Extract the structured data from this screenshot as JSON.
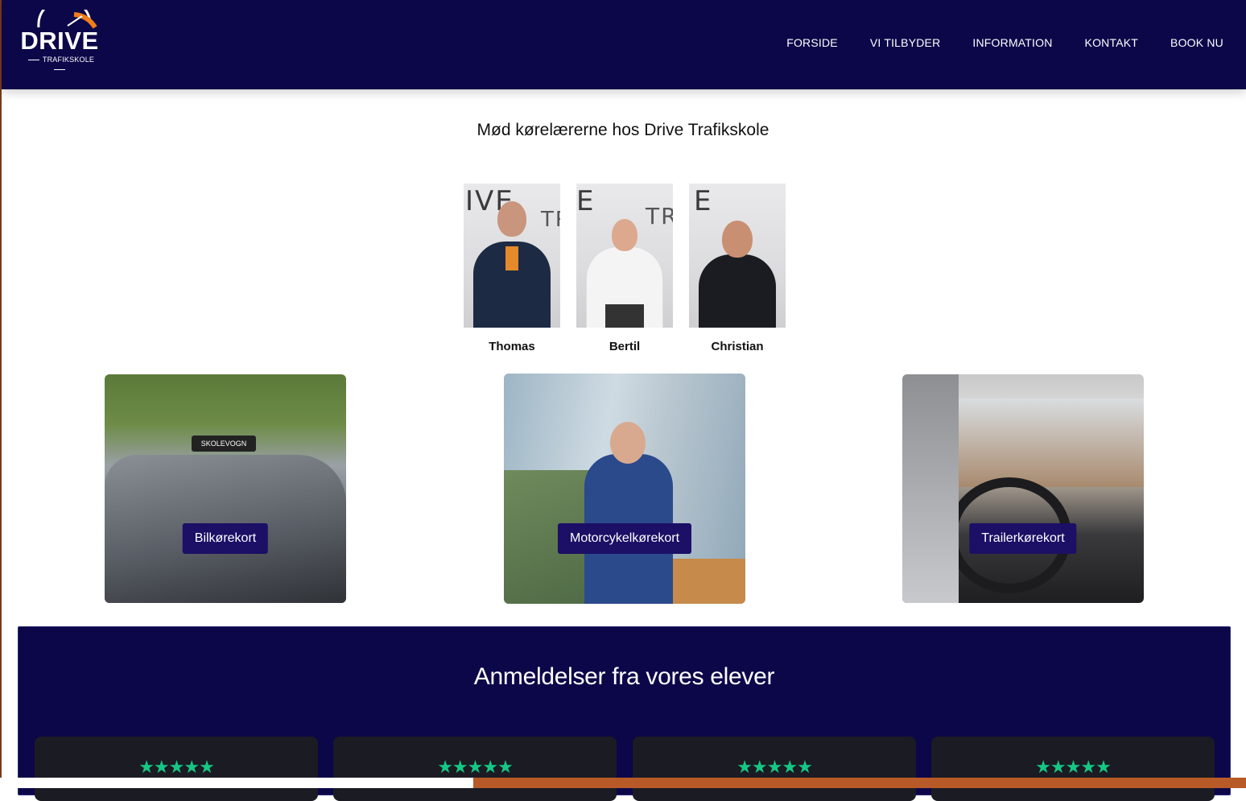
{
  "brand": {
    "name": "DRIVE",
    "tagline": "TRAFIKSKOLE",
    "primary_color": "#0c0749",
    "accent_color": "#f07d1a",
    "star_color": "#16c784"
  },
  "nav": {
    "items": [
      {
        "label": "FORSIDE"
      },
      {
        "label": "VI TILBYDER"
      },
      {
        "label": "INFORMATION"
      },
      {
        "label": "KONTAKT"
      },
      {
        "label": "BOOK NU"
      }
    ]
  },
  "instructors": {
    "title": "Mød kørelærerne hos Drive Trafikskole",
    "people": [
      {
        "name": "Thomas"
      },
      {
        "name": "Bertil"
      },
      {
        "name": "Christian"
      }
    ]
  },
  "courses": [
    {
      "label": "Bilkørekort"
    },
    {
      "label": "Motorcykelkørekort"
    },
    {
      "label": "Trailerkørekort"
    }
  ],
  "reviews": {
    "title": "Anmeldelser fra vores elever",
    "cards": [
      {
        "stars": "★★★★★",
        "rating": 5
      },
      {
        "stars": "★★★★★",
        "rating": 5
      },
      {
        "stars": "★★★★★",
        "rating": 5
      },
      {
        "stars": "★★★★★",
        "rating": 5
      }
    ]
  }
}
